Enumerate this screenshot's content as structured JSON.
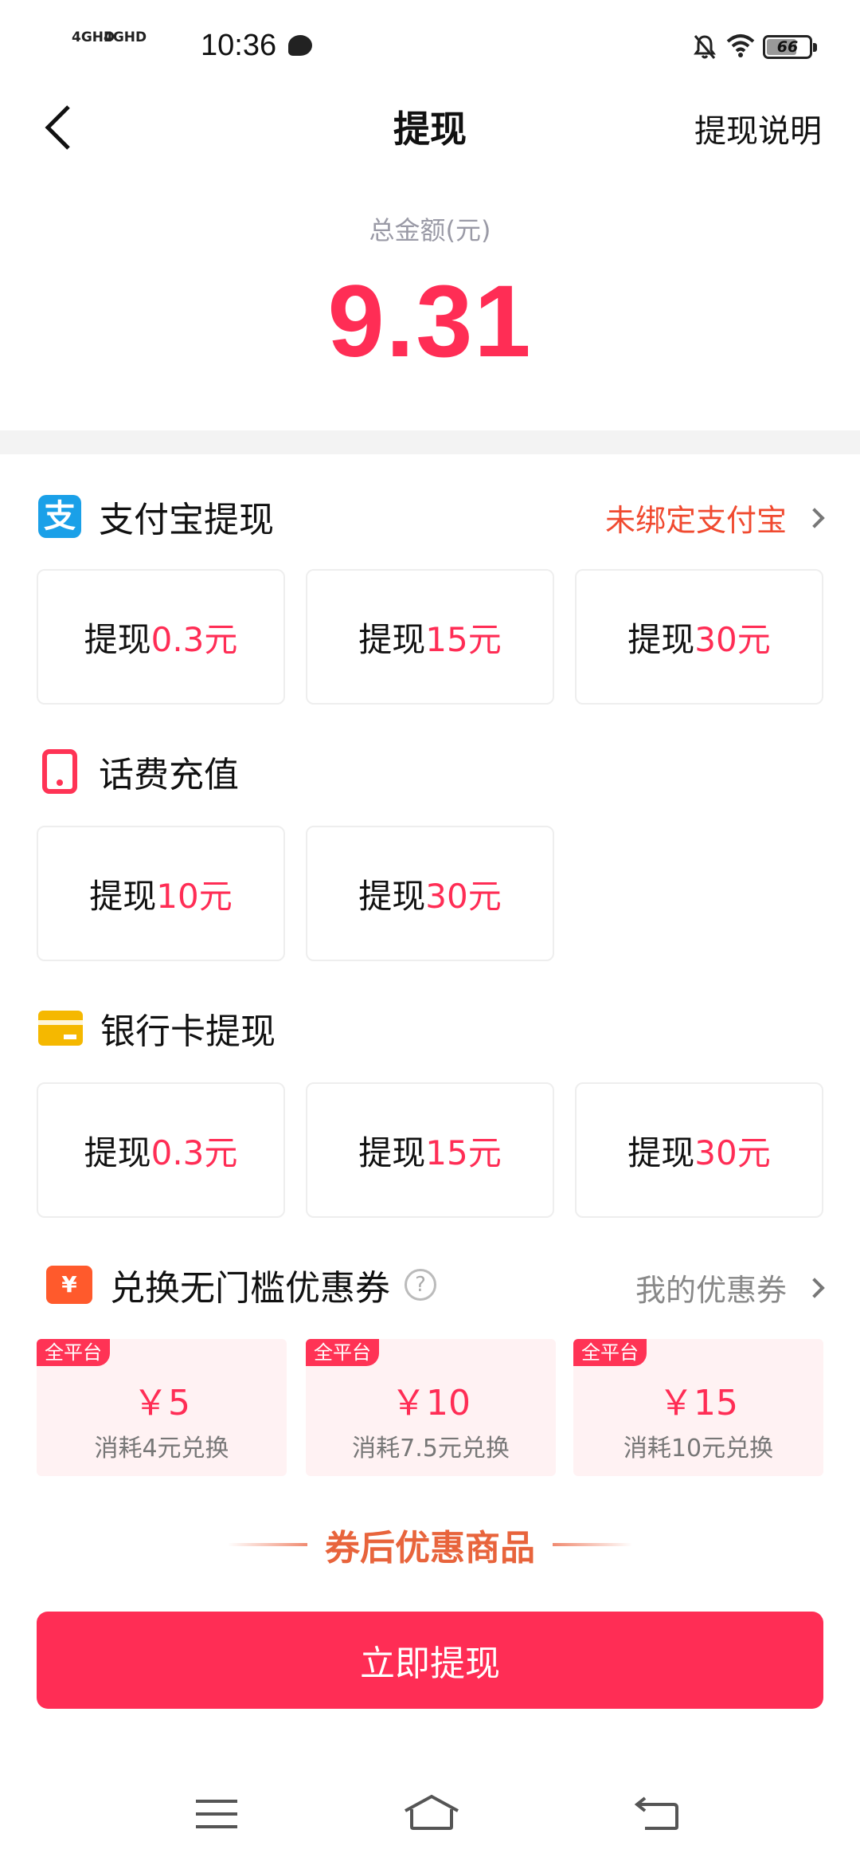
{
  "status_bar": {
    "signal1_label": "4GHD",
    "signal2_label": "4GHD",
    "time": "10:36",
    "battery": "66"
  },
  "header": {
    "title": "提现",
    "help_link": "提现说明"
  },
  "balance": {
    "label": "总金额(元)",
    "value": "9.31"
  },
  "alipay": {
    "title": "支付宝提现",
    "icon_char": "支",
    "bind_status": "未绑定支付宝",
    "options": [
      {
        "prefix": "提现",
        "amount": "0.3元"
      },
      {
        "prefix": "提现",
        "amount": "15元"
      },
      {
        "prefix": "提现",
        "amount": "30元"
      }
    ]
  },
  "phone": {
    "title": "话费充值",
    "options": [
      {
        "prefix": "提现",
        "amount": "10元"
      },
      {
        "prefix": "提现",
        "amount": "30元"
      }
    ]
  },
  "bank": {
    "title": "银行卡提现",
    "options": [
      {
        "prefix": "提现",
        "amount": "0.3元"
      },
      {
        "prefix": "提现",
        "amount": "15元"
      },
      {
        "prefix": "提现",
        "amount": "30元"
      }
    ]
  },
  "coupons": {
    "title": "兑换无门槛优惠券",
    "icon_char": "¥",
    "help_char": "?",
    "my_coupons_link": "我的优惠券",
    "items": [
      {
        "tag": "全平台",
        "amount": "￥5",
        "cost": "消耗4元兑换"
      },
      {
        "tag": "全平台",
        "amount": "￥10",
        "cost": "消耗7.5元兑换"
      },
      {
        "tag": "全平台",
        "amount": "￥15",
        "cost": "消耗10元兑换"
      }
    ]
  },
  "promo_heading": "券后优惠商品",
  "submit_label": "立即提现",
  "colors": {
    "accent": "#ff2d55",
    "alipay_blue": "#1aa0e8",
    "card_yellow": "#f5b800",
    "coupon_orange": "#ff5a2c",
    "promo_orange": "#e8643c"
  },
  "icons": [
    "back-icon",
    "alipay-icon",
    "phone-icon",
    "bank-card-icon",
    "coupon-icon",
    "help-icon",
    "chevron-right-icon",
    "menu-icon",
    "home-icon",
    "nav-back-icon"
  ]
}
